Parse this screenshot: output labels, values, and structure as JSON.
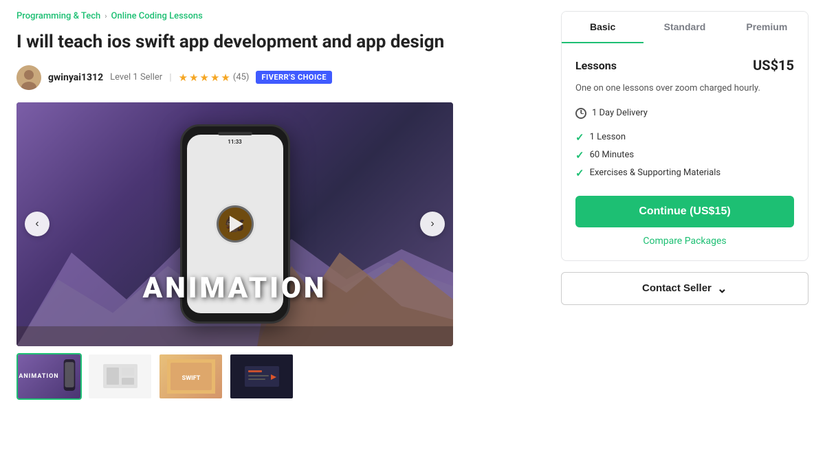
{
  "breadcrumb": {
    "parent": "Programming & Tech",
    "child": "Online Coding Lessons",
    "separator": "›"
  },
  "gig": {
    "title": "I will teach ios swift app development and app design"
  },
  "seller": {
    "name": "gwinyai1312",
    "level": "Level 1 Seller",
    "rating": "5",
    "review_count": "(45)",
    "badge": "FIVERR'S CHOICE"
  },
  "stars": [
    "★",
    "★",
    "★",
    "★",
    "★"
  ],
  "media": {
    "animation_label": "ANIMATION",
    "phone_time": "11:33"
  },
  "thumbnails": [
    {
      "id": 1,
      "label": "ANIMATION",
      "active": true
    },
    {
      "id": 2,
      "label": "",
      "active": false
    },
    {
      "id": 3,
      "label": "",
      "active": false
    },
    {
      "id": 4,
      "label": "",
      "active": false
    }
  ],
  "package_tabs": [
    {
      "id": "basic",
      "label": "Basic",
      "active": true
    },
    {
      "id": "standard",
      "label": "Standard",
      "active": false
    },
    {
      "id": "premium",
      "label": "Premium",
      "active": false
    }
  ],
  "package": {
    "name": "Lessons",
    "price": "US$15",
    "description": "One on one lessons over zoom charged hourly.",
    "delivery": "1 Day Delivery",
    "features": [
      "1 Lesson",
      "60 Minutes",
      "Exercises & Supporting Materials"
    ],
    "continue_label": "Continue (US$15)",
    "compare_label": "Compare Packages"
  },
  "contact": {
    "label": "Contact Seller",
    "chevron": "⌄"
  },
  "colors": {
    "green": "#1dbf73",
    "blue_badge": "#405BFF",
    "star": "#f5a623"
  }
}
